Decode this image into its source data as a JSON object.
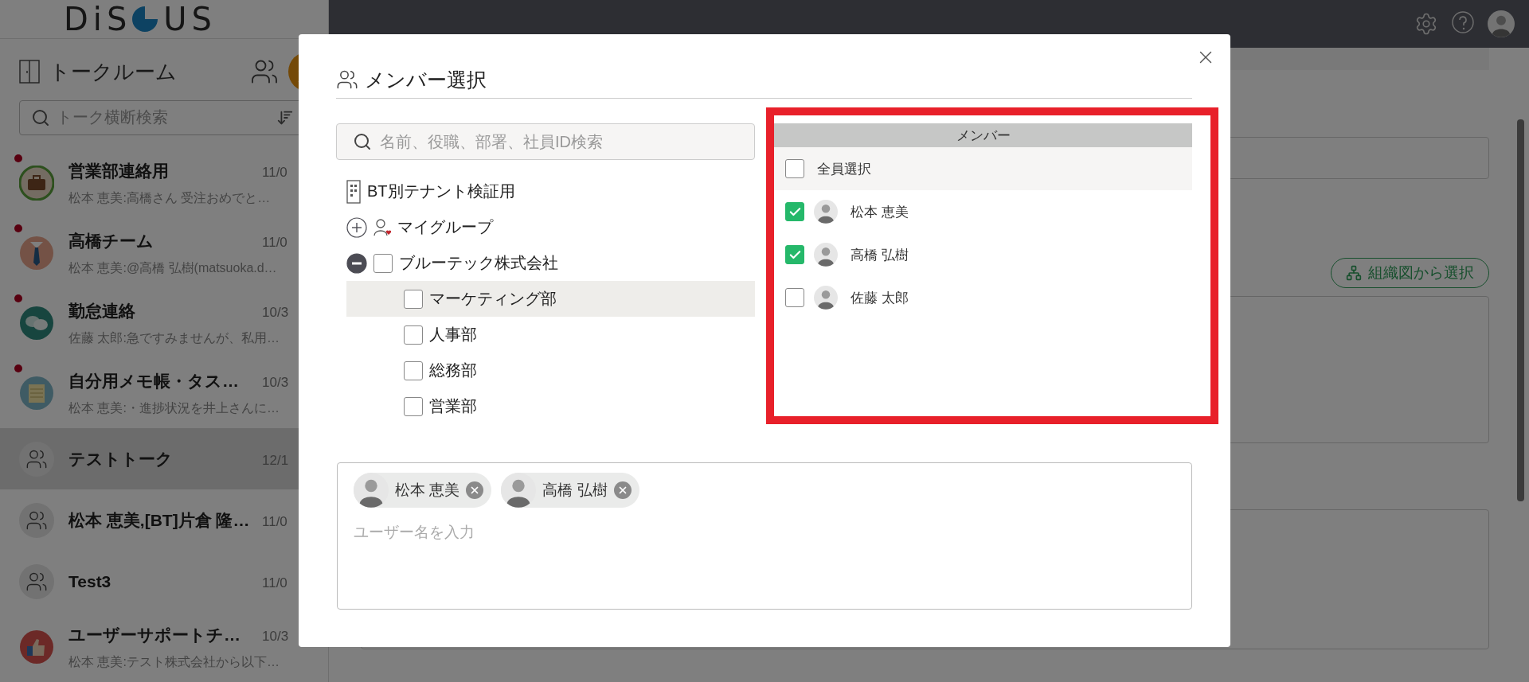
{
  "app": {
    "logo": {
      "left": "DiS",
      "right": "US"
    }
  },
  "sidebar": {
    "title": "トークルーム",
    "search": {
      "placeholder": "トーク横断検索"
    },
    "rooms": [
      {
        "name": "営業部連絡用",
        "date": "11/0",
        "preview": "松本 恵美:高橋さん 受注おめでと…",
        "kind": "briefcase",
        "unread": true,
        "selected": false
      },
      {
        "name": "高橋チーム",
        "date": "11/0",
        "preview": "松本 恵美:@高橋 弘樹(matsuoka.d…",
        "kind": "tie",
        "unread": true,
        "selected": false
      },
      {
        "name": "勤怠連絡",
        "date": "10/3",
        "preview": "佐藤 太郎:急ですみませんが、私用…",
        "kind": "chat",
        "unread": true,
        "selected": false
      },
      {
        "name": "自分用メモ帳・タス…",
        "date": "10/3",
        "preview": "松本 恵美:・進捗状況を井上さんに…",
        "kind": "notepad",
        "unread": true,
        "selected": false
      },
      {
        "name": "テストトーク",
        "date": "12/1",
        "kind": "group",
        "unread": false,
        "selected": true
      },
      {
        "name": "松本 恵美,[BT]片倉 隆…",
        "date": "11/0",
        "kind": "group",
        "unread": false,
        "selected": false
      },
      {
        "name": "Test3",
        "date": "11/0",
        "kind": "group",
        "unread": false,
        "selected": false
      },
      {
        "name": "ユーザーサポートチ…",
        "date": "10/3",
        "preview": "松本 恵美:テスト株式会社から以下…",
        "kind": "thumbsup",
        "unread": false,
        "selected": false
      }
    ]
  },
  "main": {
    "org_button": "組織図から選択"
  },
  "dialog": {
    "title": "メンバー選択",
    "search": {
      "placeholder": "名前、役職、部署、社員ID検索"
    },
    "tree": [
      {
        "kind": "tenant",
        "label": "BT別テナント検証用"
      },
      {
        "kind": "mygroup",
        "label": "マイグループ",
        "expanded": false
      },
      {
        "kind": "company",
        "label": "ブルーテック株式会社",
        "expanded": true,
        "checked": false,
        "children": [
          {
            "label": "マーケティング部",
            "checked": false,
            "highlighted": true
          },
          {
            "label": "人事部",
            "checked": false,
            "highlighted": false
          },
          {
            "label": "総務部",
            "checked": false,
            "highlighted": false
          },
          {
            "label": "営業部",
            "checked": false,
            "highlighted": false
          }
        ]
      }
    ],
    "members": {
      "header": "メンバー",
      "select_all": {
        "label": "全員選択",
        "checked": false
      },
      "items": [
        {
          "name": "松本 恵美",
          "checked": true
        },
        {
          "name": "高橋 弘樹",
          "checked": true
        },
        {
          "name": "佐藤 太郎",
          "checked": false
        }
      ]
    },
    "chips": [
      {
        "name": "松本 恵美"
      },
      {
        "name": "高橋 弘樹"
      }
    ],
    "input": {
      "placeholder": "ユーザー名を入力"
    }
  }
}
